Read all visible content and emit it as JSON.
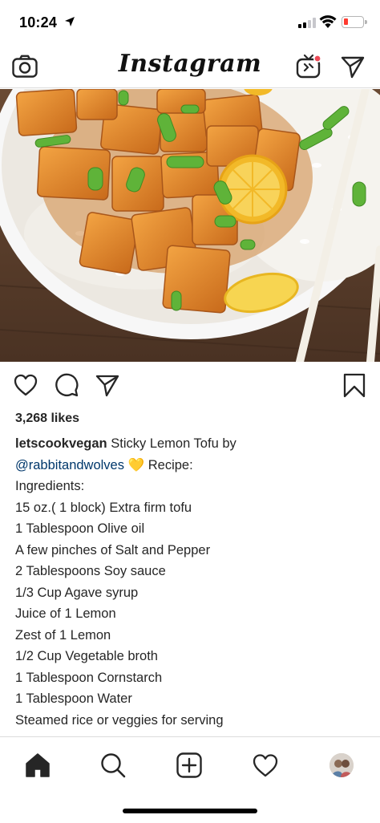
{
  "status_bar": {
    "time": "10:24",
    "battery_color": "#ff3b30"
  },
  "header": {
    "logo_text": "Instagram",
    "left_icon": "camera-icon",
    "right_icons": [
      "igtv-icon",
      "direct-message-icon"
    ],
    "igtv_badge_color": "#ed4956"
  },
  "post": {
    "image": {
      "subject": "food-photo",
      "colors": {
        "tofu": "#e0822a",
        "rice": "#f3f1ec",
        "table": "#5a3e2b",
        "bowl": "#f7f7f7"
      }
    },
    "actions": {
      "icons": [
        "heart-icon",
        "comment-icon",
        "share-icon",
        "bookmark-icon"
      ]
    },
    "likes": "3,268 likes",
    "caption": {
      "username": "letscookvegan",
      "title_text": "Sticky Lemon Tofu by",
      "mention": "@rabbitandwolves",
      "emoji": "💛",
      "after_emoji": "Recipe:",
      "lines": [
        "Ingredients:",
        "15 oz.( 1 block) Extra firm tofu",
        "1 Tablespoon Olive oil",
        "A few pinches of Salt and Pepper",
        "2 Tablespoons Soy sauce",
        "1/3 Cup Agave syrup",
        "Juice of 1 Lemon",
        "Zest of 1 Lemon",
        "1/2 Cup Vegetable broth",
        "1 Tablespoon Cornstarch",
        "1 Tablespoon Water",
        "Steamed rice or veggies for serving"
      ],
      "mention_color": "#00376b"
    }
  },
  "bottom_nav": {
    "items": [
      "home-icon",
      "search-icon",
      "add-post-icon",
      "activity-heart-icon",
      "profile-avatar"
    ]
  }
}
